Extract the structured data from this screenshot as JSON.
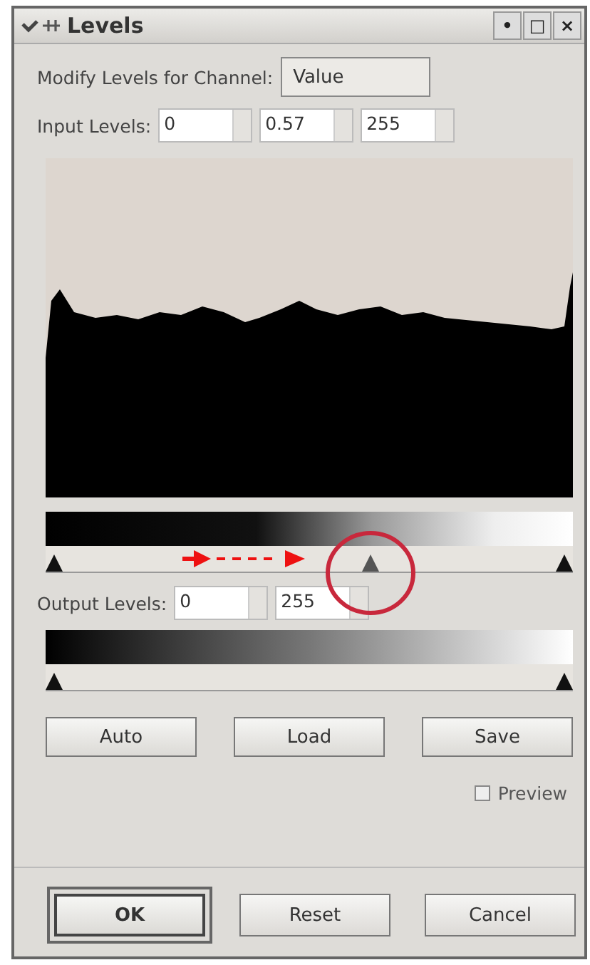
{
  "window": {
    "title": "Levels",
    "controls": [
      "•",
      "□",
      "×"
    ]
  },
  "channel": {
    "label": "Modify Levels for Channel:",
    "value": "Value"
  },
  "input_levels": {
    "label": "Input Levels:",
    "fields": [
      {
        "value": "0"
      },
      {
        "value": "0.57"
      },
      {
        "value": "255"
      }
    ],
    "handles": [
      {
        "level": 0
      },
      {
        "level": 0.62
      },
      {
        "level": 1
      }
    ]
  },
  "output_levels": {
    "label": "Output Levels:",
    "fields": [
      {
        "value": "0"
      },
      {
        "value": "255"
      }
    ],
    "handles": [
      {
        "level": 0
      },
      {
        "level": 1
      }
    ]
  },
  "actions": [
    "Auto",
    "Load",
    "Save"
  ],
  "preview": {
    "label": "Preview",
    "checked": false
  },
  "buttons": [
    {
      "label": "OK",
      "default": true
    },
    {
      "label": "Reset",
      "default": false
    },
    {
      "label": "Cancel",
      "default": false
    }
  ]
}
